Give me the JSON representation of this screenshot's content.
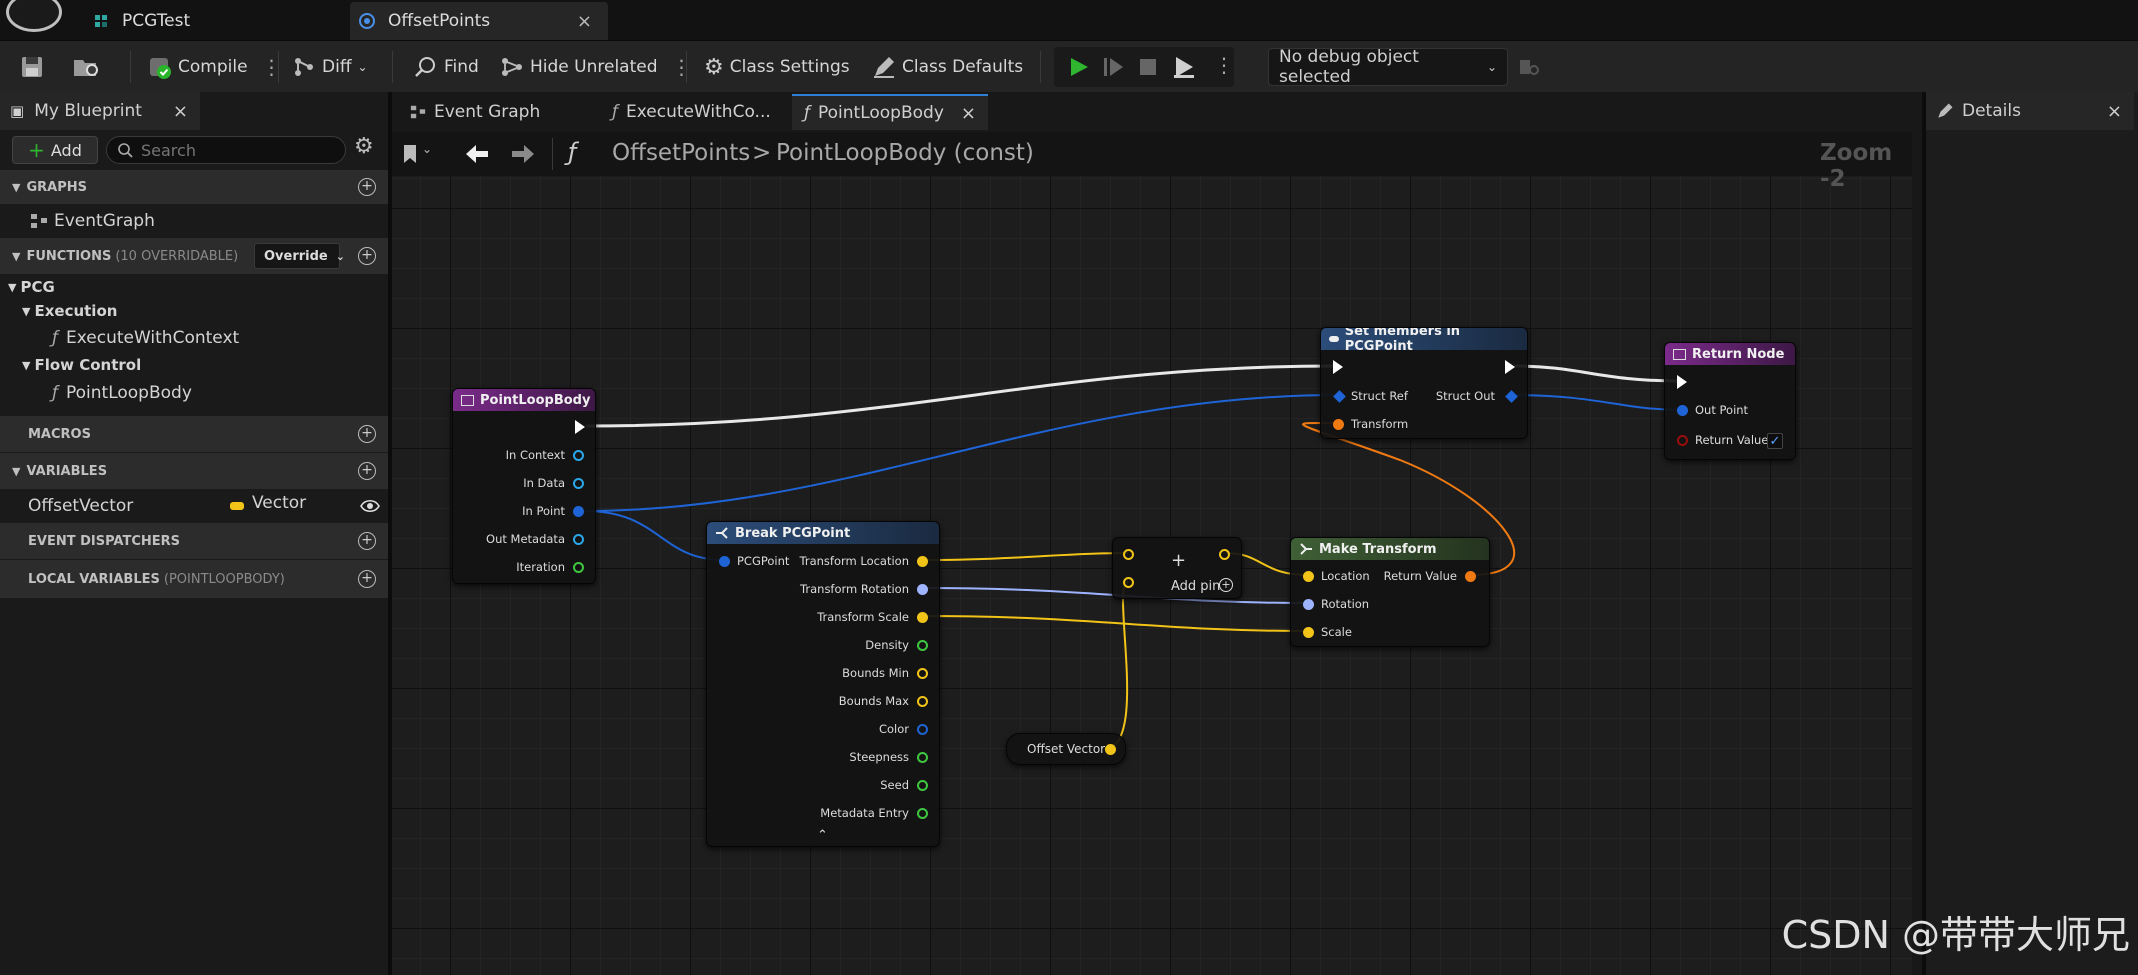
{
  "window": {
    "tabs": [
      {
        "label": "PCGTest"
      },
      {
        "label": "OffsetPoints"
      }
    ],
    "close_glyph": "×"
  },
  "toolbar": {
    "compile": "Compile",
    "diff": "Diff",
    "find": "Find",
    "hide_unrelated": "Hide Unrelated",
    "class_settings": "Class Settings",
    "class_defaults": "Class Defaults",
    "debug_object": "No debug object selected"
  },
  "my_blueprint": {
    "title": "My Blueprint",
    "add_label": "Add",
    "search_placeholder": "Search",
    "sections": {
      "graphs": "GRAPHS",
      "functions": "FUNCTIONS",
      "functions_note": "(10 OVERRIDABLE)",
      "override": "Override",
      "macros": "MACROS",
      "variables": "VARIABLES",
      "event_dispatchers": "EVENT DISPATCHERS",
      "local_variables": "LOCAL VARIABLES",
      "local_variables_note": "(POINTLOOPBODY)"
    },
    "graph_items": [
      "EventGraph"
    ],
    "categories": {
      "pcg": "PCG",
      "execution": "Execution",
      "execute_item": "ExecuteWithContext",
      "flow_control": "Flow Control",
      "flow_item": "PointLoopBody"
    },
    "variable": {
      "name": "OffsetVector",
      "type": "Vector"
    }
  },
  "graph_tabs": [
    {
      "label": "Event Graph"
    },
    {
      "label": "ExecuteWithCo..."
    },
    {
      "label": "PointLoopBody"
    }
  ],
  "breadcrumb": {
    "blueprint": "OffsetPoints",
    "separator": ">",
    "function": "PointLoopBody (const)",
    "zoom": "Zoom -2"
  },
  "details": {
    "title": "Details"
  },
  "nodes": {
    "point_loop_body": {
      "title": "PointLoopBody",
      "pins": [
        "In Context",
        "In Data",
        "In Point",
        "Out Metadata",
        "Iteration"
      ]
    },
    "break_pcg_point": {
      "title": "Break PCGPoint",
      "input": "PCGPoint",
      "pins": [
        "Transform Location",
        "Transform Rotation",
        "Transform Scale",
        "Density",
        "Bounds Min",
        "Bounds Max",
        "Color",
        "Steepness",
        "Seed",
        "Metadata Entry"
      ]
    },
    "add": {
      "plus": "+",
      "label": "Add pin"
    },
    "offset_vector": {
      "label": "Offset Vector"
    },
    "make_transform": {
      "title": "Make Transform",
      "inputs": [
        "Location",
        "Rotation",
        "Scale"
      ],
      "output": "Return Value"
    },
    "set_members": {
      "title": "Set members in PCGPoint",
      "struct_ref": "Struct Ref",
      "struct_out": "Struct Out",
      "transform": "Transform"
    },
    "return_node": {
      "title": "Return Node",
      "pins": [
        "Out Point",
        "Return Value"
      ]
    }
  },
  "colors": {
    "exec": "#ffffff",
    "struct": "#1e64d6",
    "vector": "#f2c418",
    "rotator": "#9fb4ff",
    "transform": "#f07a12",
    "float": "#3fc73f",
    "boolean": "#9b0c0c",
    "function_head": "#7b2b8a",
    "pure_head": "#2c4d7a",
    "make_head": "#3f6036"
  },
  "watermark": "CSDN @带带大师兄"
}
